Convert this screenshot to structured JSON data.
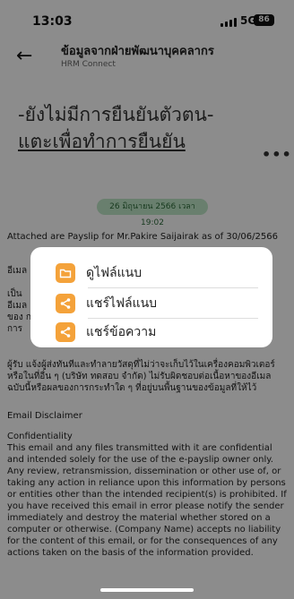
{
  "status_bar": {
    "time": "13:03",
    "network": "5G",
    "battery": "86"
  },
  "header": {
    "back_icon": "arrow-left-icon",
    "title": "ข้อมูลจากฝ่ายพัฒนาบุคคลากร",
    "subtitle": "HRM Connect"
  },
  "notice": {
    "line1": "-ยังไม่มีการยืนยันตัวตน-",
    "line2": "แตะเพื่อทำการยืนยัน"
  },
  "more_icon": "more-horizontal-icon",
  "message": {
    "date": "26 มิถุนายน 2566 เวลา 19:02",
    "intro": "Attached are Payslip for Mr.Pakire Saijairak as of 30/06/2566",
    "paragraph_a": "อีเมล",
    "paragraph_b": "เป็น อีเมล ของ การ การ",
    "paragraph_c": "ผู้รับ แจ้งผู้ส่งทันทีและทำลายวัสดุที่ไม่ว่าจะเก็บไว้ในเครื่องคอมพิวเตอร์หรือในที่อื่น ๆ (บริษัท ทดสอบ จำกัด) ไม่รับผิดชอบต่อเนื้อหาของอีเมลฉบับนี้หรือผลของการกระทำใด ๆ ที่อยู่บนพื้นฐานของข้อมูลที่ให้ไว้",
    "disclaimer_heading": "Email Disclaimer",
    "confidentiality_heading": "Confidentiality",
    "confidentiality_text": "This email and any files transmitted with it are confidential and intended solely for the use of the e-payslip owner only. Any review, retransmission, dissemination or other use of, or taking any action in reliance upon this information by persons or entities other than the intended recipient(s) is prohibited. If you have received this email in error please notify the sender immediately and destroy the material whether stored on a computer or otherwise. (Company Name) accepts no liability for the content of this email, or for the consequences of any actions taken on the basis of the information provided."
  },
  "popup": {
    "items": [
      {
        "label": "ดูไฟล์แนบ",
        "icon": "folder-icon"
      },
      {
        "label": "แชร์ไฟล์แนบ",
        "icon": "share-icon"
      },
      {
        "label": "แชร์ข้อความ",
        "icon": "share-icon"
      }
    ]
  },
  "colors": {
    "accent": "#f4a23a",
    "date_pill_bg": "#bfe8c8",
    "dim_overlay": "rgba(0,0,0,0.45)"
  }
}
